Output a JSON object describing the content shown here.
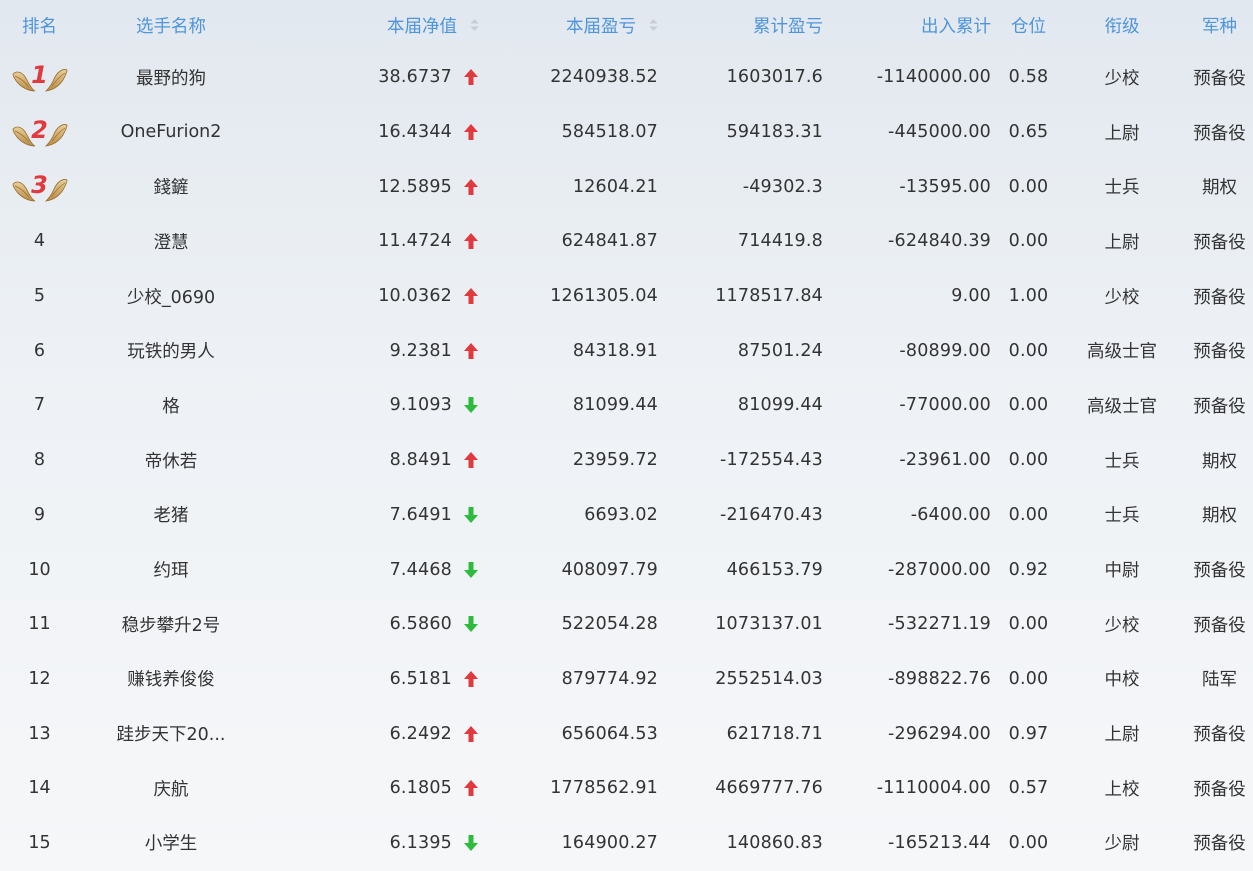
{
  "colors": {
    "header_text": "#4f95dc",
    "cell_text": "#333333",
    "up_arrow": "#e0393e",
    "down_arrow": "#2dbb3d",
    "medal_number": "#e0393e",
    "medal_wing": "#b88a43"
  },
  "headers": {
    "rank": "排名",
    "name": "选手名称",
    "net": "本届净值",
    "profit": "本届盈亏",
    "cumulative": "累计盈亏",
    "flow": "出入累计",
    "position": "仓位",
    "title": "衔级",
    "branch": "军种"
  },
  "rows": [
    {
      "rank": "1",
      "medal": true,
      "name": "最野的狗",
      "net": "38.6737",
      "trend": "up",
      "profit": "2240938.52",
      "cumulative": "1603017.6",
      "flow": "-1140000.00",
      "position": "0.58",
      "title": "少校",
      "branch": "预备役"
    },
    {
      "rank": "2",
      "medal": true,
      "name": "OneFurion2",
      "net": "16.4344",
      "trend": "up",
      "profit": "584518.07",
      "cumulative": "594183.31",
      "flow": "-445000.00",
      "position": "0.65",
      "title": "上尉",
      "branch": "预备役"
    },
    {
      "rank": "3",
      "medal": true,
      "name": "錢鏟",
      "net": "12.5895",
      "trend": "up",
      "profit": "12604.21",
      "cumulative": "-49302.3",
      "flow": "-13595.00",
      "position": "0.00",
      "title": "士兵",
      "branch": "期权"
    },
    {
      "rank": "4",
      "medal": false,
      "name": "澄慧",
      "net": "11.4724",
      "trend": "up",
      "profit": "624841.87",
      "cumulative": "714419.8",
      "flow": "-624840.39",
      "position": "0.00",
      "title": "上尉",
      "branch": "预备役"
    },
    {
      "rank": "5",
      "medal": false,
      "name": "少校_0690",
      "net": "10.0362",
      "trend": "up",
      "profit": "1261305.04",
      "cumulative": "1178517.84",
      "flow": "9.00",
      "position": "1.00",
      "title": "少校",
      "branch": "预备役"
    },
    {
      "rank": "6",
      "medal": false,
      "name": "玩铁的男人",
      "net": "9.2381",
      "trend": "up",
      "profit": "84318.91",
      "cumulative": "87501.24",
      "flow": "-80899.00",
      "position": "0.00",
      "title": "高级士官",
      "branch": "预备役"
    },
    {
      "rank": "7",
      "medal": false,
      "name": "格",
      "net": "9.1093",
      "trend": "down",
      "profit": "81099.44",
      "cumulative": "81099.44",
      "flow": "-77000.00",
      "position": "0.00",
      "title": "高级士官",
      "branch": "预备役"
    },
    {
      "rank": "8",
      "medal": false,
      "name": "帝休若",
      "net": "8.8491",
      "trend": "up",
      "profit": "23959.72",
      "cumulative": "-172554.43",
      "flow": "-23961.00",
      "position": "0.00",
      "title": "士兵",
      "branch": "期权"
    },
    {
      "rank": "9",
      "medal": false,
      "name": "老猪",
      "net": "7.6491",
      "trend": "down",
      "profit": "6693.02",
      "cumulative": "-216470.43",
      "flow": "-6400.00",
      "position": "0.00",
      "title": "士兵",
      "branch": "期权"
    },
    {
      "rank": "10",
      "medal": false,
      "name": "约珥",
      "net": "7.4468",
      "trend": "down",
      "profit": "408097.79",
      "cumulative": "466153.79",
      "flow": "-287000.00",
      "position": "0.92",
      "title": "中尉",
      "branch": "预备役"
    },
    {
      "rank": "11",
      "medal": false,
      "name": "稳步攀升2号",
      "net": "6.5860",
      "trend": "down",
      "profit": "522054.28",
      "cumulative": "1073137.01",
      "flow": "-532271.19",
      "position": "0.00",
      "title": "少校",
      "branch": "预备役"
    },
    {
      "rank": "12",
      "medal": false,
      "name": "赚钱养俊俊",
      "net": "6.5181",
      "trend": "up",
      "profit": "879774.92",
      "cumulative": "2552514.03",
      "flow": "-898822.76",
      "position": "0.00",
      "title": "中校",
      "branch": "陆军"
    },
    {
      "rank": "13",
      "medal": false,
      "name": "跬步天下20...",
      "net": "6.2492",
      "trend": "up",
      "profit": "656064.53",
      "cumulative": "621718.71",
      "flow": "-296294.00",
      "position": "0.97",
      "title": "上尉",
      "branch": "预备役"
    },
    {
      "rank": "14",
      "medal": false,
      "name": "庆航",
      "net": "6.1805",
      "trend": "up",
      "profit": "1778562.91",
      "cumulative": "4669777.76",
      "flow": "-1110004.00",
      "position": "0.57",
      "title": "上校",
      "branch": "预备役"
    },
    {
      "rank": "15",
      "medal": false,
      "name": "小学生",
      "net": "6.1395",
      "trend": "down",
      "profit": "164900.27",
      "cumulative": "140860.83",
      "flow": "-165213.44",
      "position": "0.00",
      "title": "少尉",
      "branch": "预备役"
    }
  ]
}
